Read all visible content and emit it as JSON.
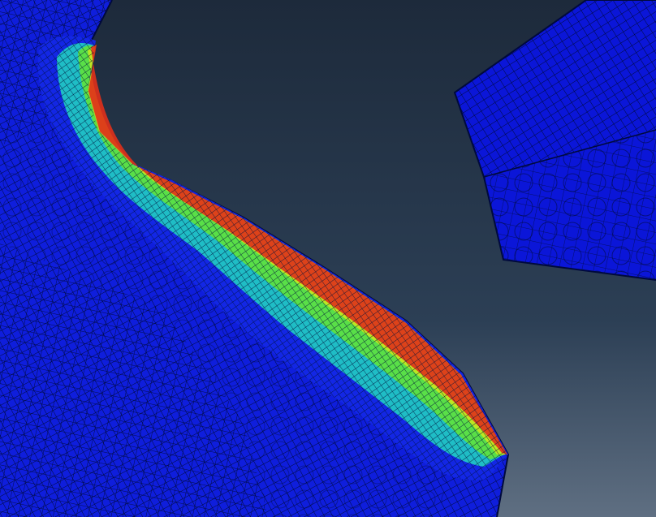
{
  "scene": {
    "background_top": "#1d2a3b",
    "background_mid": "#2c3f55",
    "background_bottom": "#5f6f82"
  },
  "parts": {
    "gear_tooth": {
      "base_color": "#0f1edc",
      "mesh_color": "#000a3c"
    },
    "mating_tooth": {
      "base_color": "#0b16d8",
      "mesh_color": "#000a3c"
    }
  },
  "contour": {
    "colormap": [
      "#1428e6",
      "#1aa6e0",
      "#22d8c0",
      "#5fe23a",
      "#c8e81e",
      "#f09a14",
      "#e0301a"
    ]
  }
}
